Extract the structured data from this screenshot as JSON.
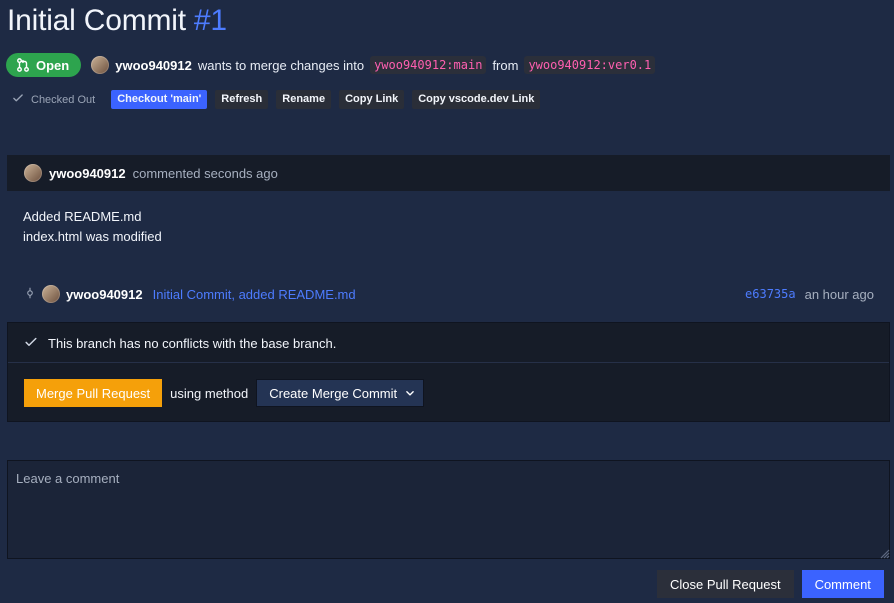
{
  "header": {
    "title": "Initial Commit",
    "number": "#1"
  },
  "pr": {
    "status": "Open",
    "author": "ywoo940912",
    "merge_text": "wants to merge changes into",
    "target_branch": "ywoo940912:main",
    "from_text": "from",
    "source_branch": "ywoo940912:ver0.1"
  },
  "actions": {
    "checked_out": "Checked Out",
    "checkout_main": "Checkout 'main'",
    "refresh": "Refresh",
    "rename": "Rename",
    "copy_link": "Copy Link",
    "copy_vscode": "Copy vscode.dev Link"
  },
  "comment": {
    "author": "ywoo940912",
    "meta": "commented seconds ago",
    "body_lines": [
      "Added README.md",
      "index.html was modified"
    ]
  },
  "commit": {
    "author": "ywoo940912",
    "message": "Initial Commit, added README.md",
    "hash": "e63735a",
    "time": "an hour ago"
  },
  "merge": {
    "status_text": "This branch has no conflicts with the base branch.",
    "button_label": "Merge Pull Request",
    "using_label": "using method",
    "method_selected": "Create Merge Commit"
  },
  "new_comment": {
    "placeholder": "Leave a comment"
  },
  "footer": {
    "close_label": "Close Pull Request",
    "comment_label": "Comment"
  },
  "colors": {
    "background": "#1e2a44",
    "accent_blue": "#3b63ff",
    "open_green": "#2da44e",
    "merge_orange": "#f5a00a",
    "branch_pink": "#ff5fb0"
  }
}
